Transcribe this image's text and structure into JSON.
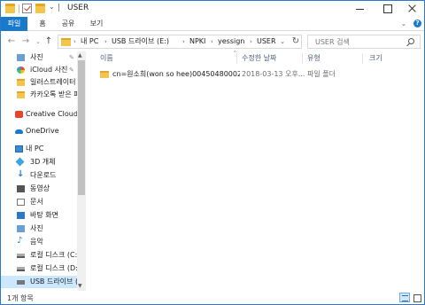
{
  "window": {
    "title": "USER",
    "title_separator": "|"
  },
  "ribbon": {
    "tabs": [
      "파일",
      "홈",
      "공유",
      "보기"
    ],
    "active_tab": "파일",
    "accent": "#1979ca",
    "help": "?",
    "expand": "⌄"
  },
  "nav": {
    "back": "←",
    "forward": "→",
    "recent": "⌄",
    "up": "↑"
  },
  "address": {
    "separator": "›",
    "crumbs": [
      "내 PC",
      "USB 드라이브 (E:)",
      "NPKI",
      "yessign",
      "USER"
    ],
    "dropdown": "⌄",
    "refresh": "↻"
  },
  "search": {
    "placeholder": "USER 검색"
  },
  "sidebar": {
    "items": [
      {
        "label": "사진",
        "icon": "photo-icon",
        "pinned": true
      },
      {
        "label": "iCloud 사진",
        "icon": "icloud-icon",
        "pinned": true
      },
      {
        "label": "일러스트레이터",
        "icon": "folder-icon",
        "pinned": false
      },
      {
        "label": "카카오톡 받은 파",
        "icon": "folder-icon",
        "pinned": false
      },
      {
        "label": "Creative Cloud Fil",
        "icon": "creative-cloud-icon",
        "pinned": false
      },
      {
        "label": "OneDrive",
        "icon": "onedrive-icon",
        "pinned": false
      },
      {
        "label": "내 PC",
        "icon": "pc-icon",
        "pinned": false
      },
      {
        "label": "3D 개체",
        "icon": "3d-objects-icon",
        "pinned": false
      },
      {
        "label": "다운로드",
        "icon": "download-icon",
        "pinned": false
      },
      {
        "label": "동영상",
        "icon": "video-icon",
        "pinned": false
      },
      {
        "label": "문서",
        "icon": "document-icon",
        "pinned": false
      },
      {
        "label": "바탕 화면",
        "icon": "desktop-icon",
        "pinned": false
      },
      {
        "label": "사진",
        "icon": "pictures-icon",
        "pinned": false
      },
      {
        "label": "음악",
        "icon": "music-icon",
        "pinned": false
      },
      {
        "label": "로컬 디스크 (C:)",
        "icon": "drive-icon",
        "pinned": false
      },
      {
        "label": "로컬 디스크 (D:)",
        "icon": "drive-icon",
        "pinned": false
      },
      {
        "label": "USB 드라이브 (E:",
        "icon": "usb-drive-icon",
        "pinned": false,
        "selected": true
      }
    ],
    "pin_glyph": "📌"
  },
  "columns": {
    "name": "이름",
    "date": "수정한 날짜",
    "type": "유형",
    "size": "크기"
  },
  "files": [
    {
      "name": "cn=원소희(won so hee)004504800020...",
      "date": "2018-03-13 오후...",
      "type": "파일 폴더",
      "size": "",
      "icon": "folder-icon"
    }
  ],
  "status": {
    "item_count": "1개 항목"
  }
}
